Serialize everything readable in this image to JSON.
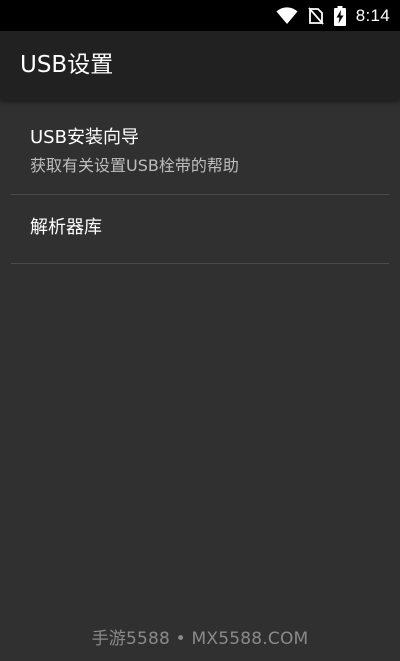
{
  "status_bar": {
    "time": "8:14",
    "icons": [
      "wifi-icon",
      "no-sim-icon",
      "battery-charging-icon"
    ]
  },
  "toolbar": {
    "title": "USB设置"
  },
  "preferences": [
    {
      "title": "USB安装向导",
      "summary": "获取有关设置USB栓带的帮助"
    },
    {
      "title": "解析器库"
    }
  ],
  "watermark": {
    "text": "手游5588 • MX5588.COM"
  },
  "colors": {
    "status_bar_bg": "#000000",
    "toolbar_bg": "#212121",
    "content_bg": "#303030",
    "divider": "#4a4a4a",
    "title_text": "#ffffff",
    "summary_text": "#bdbdbd"
  }
}
